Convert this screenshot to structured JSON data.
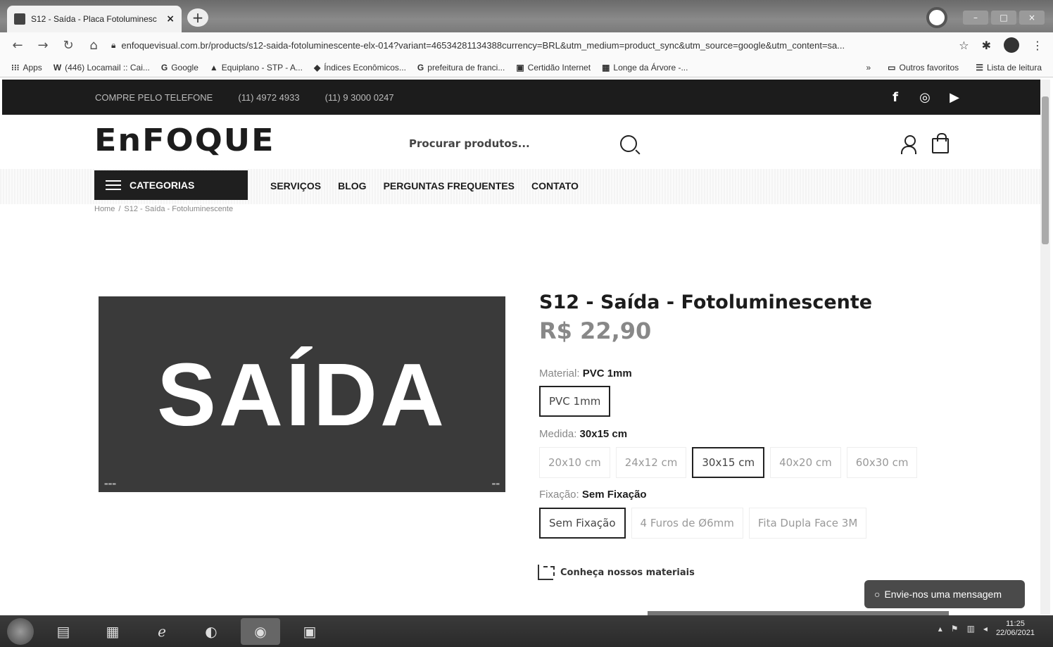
{
  "browser": {
    "tab_title": "S12 - Saída - Placa Fotoluminesc",
    "tab_close": "×",
    "new_tab": "+",
    "url": "enfoquevisual.com.br/products/s12-saida-fotoluminescente-elx-014?variant=46534281134388currency=BRL&utm_medium=product_sync&utm_source=google&utm_content=sa...",
    "bookmarks": [
      {
        "icon": "apps-grid-icon",
        "label": "Apps"
      },
      {
        "icon": "w-icon",
        "label": "(446) Locamail :: Cai..."
      },
      {
        "icon": "google-icon",
        "label": "Google"
      },
      {
        "icon": "equiplano-icon",
        "label": "Equiplano - STP - A..."
      },
      {
        "icon": "indices-icon",
        "label": "Índices Econômicos..."
      },
      {
        "icon": "google-icon",
        "label": "prefeitura de franci..."
      },
      {
        "icon": "certidao-icon",
        "label": "Certidão Internet"
      },
      {
        "icon": "longe-icon",
        "label": "Longe da Árvore -..."
      }
    ],
    "bookmarks_more": "»",
    "other_favorites": "Outros favoritos",
    "reading_list": "Lista de leitura"
  },
  "topbar": {
    "phone_label": "COMPRE PELO TELEFONE",
    "phone1": "(11) 4972 4933",
    "phone2": "(11) 9 3000 0247"
  },
  "header": {
    "logo": "EnFOQUE",
    "search_placeholder": "Procurar produtos..."
  },
  "nav": {
    "categories": "CATEGORIAS",
    "items": [
      "SERVIÇOS",
      "BLOG",
      "PERGUNTAS FREQUENTES",
      "CONTATO"
    ]
  },
  "breadcrumb": {
    "home": "Home",
    "sep": "/",
    "current": "S12 - Saída - Fotoluminescente"
  },
  "product": {
    "image_text": "SAÍDA",
    "title": "S12 - Saída - Fotoluminescente",
    "price": "R$ 22,90",
    "material": {
      "label": "Material:",
      "selected": "PVC 1mm",
      "options": [
        "PVC 1mm"
      ]
    },
    "size": {
      "label": "Medida:",
      "selected": "30x15 cm",
      "options": [
        "20x10 cm",
        "24x12 cm",
        "30x15 cm",
        "40x20 cm",
        "60x30 cm"
      ]
    },
    "fixing": {
      "label": "Fixação:",
      "selected": "Sem Fixação",
      "options": [
        "Sem Fixação",
        "4 Furos de Ø6mm",
        "Fita Dupla Face 3M"
      ]
    },
    "materials_link": "Conheça nossos materiais"
  },
  "chat": {
    "label": "Envie-nos uma mensagem"
  },
  "taskbar": {
    "time": "11:25",
    "date": "22/06/2021"
  }
}
